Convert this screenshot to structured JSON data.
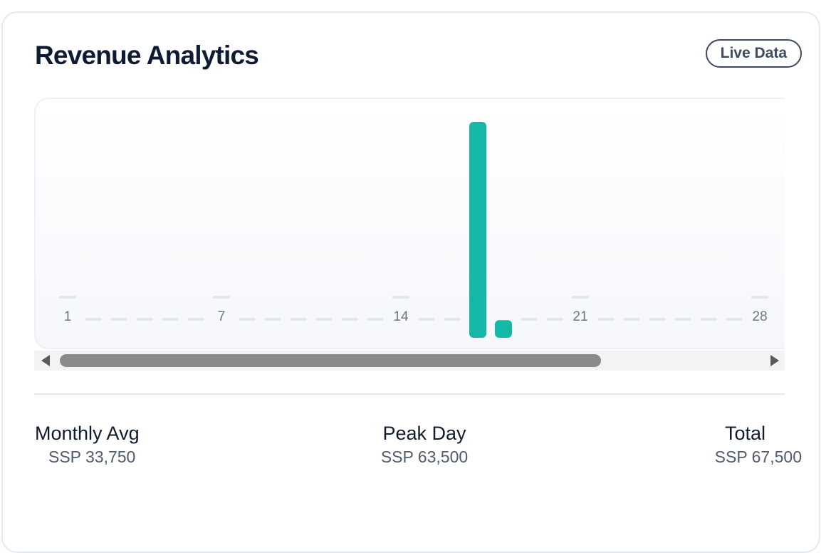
{
  "header": {
    "title": "Revenue Analytics",
    "badge": "Live Data"
  },
  "colors": {
    "bar": "#14b8a6",
    "placeholder": "#e2e6ee",
    "title": "#0f1b33"
  },
  "chart_data": {
    "type": "bar",
    "title": "",
    "xlabel": "",
    "ylabel": "",
    "x": [
      1,
      2,
      3,
      4,
      5,
      6,
      7,
      8,
      9,
      10,
      11,
      12,
      13,
      14,
      15,
      16,
      17,
      18,
      19,
      20,
      21,
      22,
      23,
      24,
      25,
      26,
      27,
      28
    ],
    "tick_labels": [
      "1",
      "7",
      "14",
      "21",
      "28"
    ],
    "values": [
      0,
      0,
      0,
      0,
      0,
      0,
      0,
      0,
      0,
      0,
      0,
      0,
      0,
      0,
      0,
      0,
      63500,
      4000,
      0,
      0,
      0,
      0,
      0,
      0,
      0,
      0,
      0,
      0
    ],
    "ylim": [
      0,
      63500
    ],
    "grid": false,
    "legend": "none",
    "currency": "SSP"
  },
  "stats": {
    "monthly_avg_label": "Monthly Avg",
    "monthly_avg_value": "SSP 33,750",
    "peak_day_label": "Peak Day",
    "peak_day_value": "SSP 63,500",
    "total_label": "Total",
    "total_value": "SSP 67,500"
  }
}
